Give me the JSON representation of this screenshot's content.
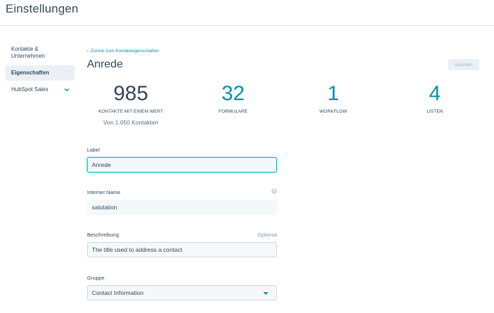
{
  "header": {
    "title": "Einstellungen"
  },
  "sidebar": {
    "items": [
      {
        "label": "Kontakte & Unternehmen"
      },
      {
        "label": "Eigenschaften"
      },
      {
        "label": "HubSpot Sales"
      }
    ]
  },
  "property": {
    "back_link": "Zurück zum Kontakteigenschaften",
    "title": "Anrede",
    "delete_label": "Löschen"
  },
  "stats": [
    {
      "value": "985",
      "label": "KONTAKTE MIT EINEM WERT",
      "sub": "Von 1.050 Kontakten"
    },
    {
      "value": "32",
      "label": "FORMULARE"
    },
    {
      "value": "1",
      "label": "WORKFLOW"
    },
    {
      "value": "4",
      "label": "LISTEN"
    }
  ],
  "form": {
    "label_field": {
      "label": "Label",
      "value": "Anrede"
    },
    "internal_name": {
      "label": "Interner Name",
      "value": "salutation"
    },
    "description": {
      "label": "Beschreibung",
      "optional": "Optional",
      "value": "The title used to address a contact"
    },
    "group": {
      "label": "Gruppe",
      "value": "Contact Information"
    }
  },
  "colors": {
    "accent": "#0091ae",
    "text": "#33475b",
    "focus": "#00bda5"
  }
}
